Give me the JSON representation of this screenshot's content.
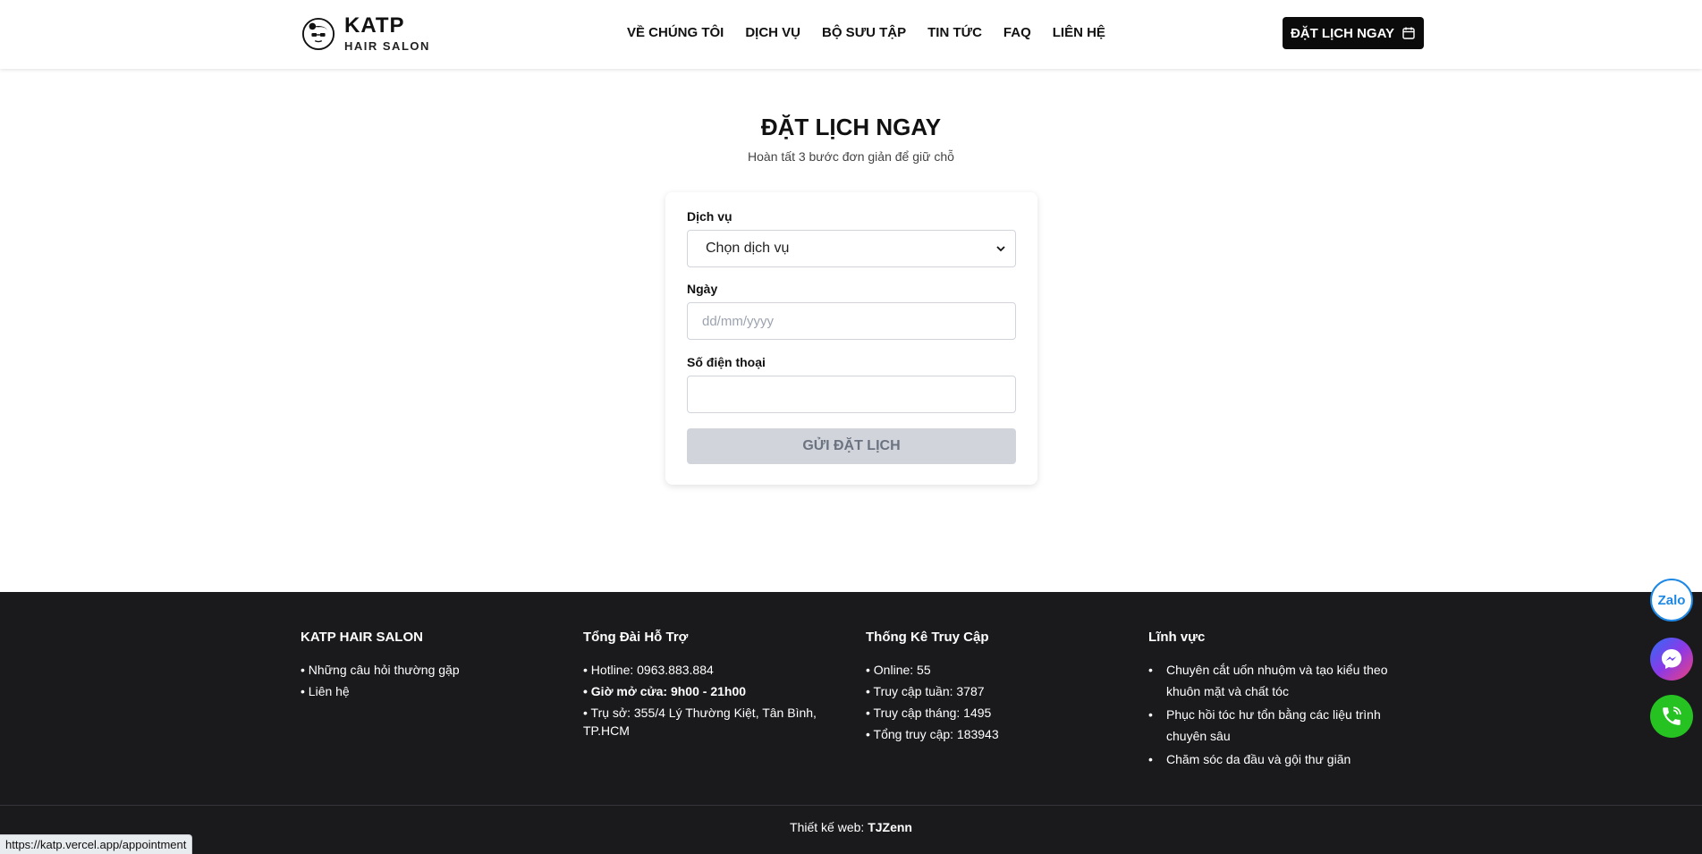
{
  "header": {
    "brand_title": "KATP",
    "brand_sub": "HAIR SALON",
    "nav": [
      "VỀ CHÚNG TÔI",
      "DỊCH VỤ",
      "BỘ SƯU TẬP",
      "TIN TỨC",
      "FAQ",
      "LIÊN HỆ"
    ],
    "cta_label": "ĐẶT LỊCH NGAY"
  },
  "main": {
    "title": "ĐẶT LỊCH NGAY",
    "subtitle": "Hoàn tất 3 bước đơn giản để giữ chỗ",
    "form": {
      "service_label": "Dịch vụ",
      "service_value": "Chọn dịch vụ",
      "date_label": "Ngày",
      "date_placeholder": "dd/mm/yyyy",
      "phone_label": "Số điện thoại",
      "phone_value": "",
      "submit_label": "GỬI ĐẶT LỊCH"
    }
  },
  "footer": {
    "col1": {
      "title": "KATP HAIR SALON",
      "items": [
        "• Những câu hỏi thường gặp",
        "• Liên hệ"
      ]
    },
    "col2": {
      "title": "Tổng Đài Hỗ Trợ",
      "items": [
        "• Hotline: 0963.883.884",
        "• Giờ mở cửa: 9h00 - 21h00",
        "• Trụ sở: 355/4 Lý Thường Kiệt, Tân Bình, TP.HCM"
      ]
    },
    "col3": {
      "title": "Thống Kê Truy Cập",
      "items": [
        "• Online: 55",
        "• Truy cập tuần: 3787",
        "• Truy cập tháng: 1495",
        "• Tổng truy cập: 183943"
      ]
    },
    "col4": {
      "title": "Lĩnh vực",
      "items": [
        "Chuyên cắt uốn nhuộm và tạo kiểu theo khuôn mặt và chất tóc",
        "Phục hồi tóc hư tổn bằng các liệu trình chuyên sâu",
        "Chăm sóc da đầu và gội thư giãn"
      ]
    },
    "credit_prefix": "Thiết kế web:",
    "credit_name": "TJZenn"
  },
  "floating": {
    "zalo_label": "Zalo"
  },
  "status_bar": {
    "url": "https://katp.vercel.app/appointment"
  },
  "colors": {
    "dark": "#1a1a1d",
    "cta": "#0b0b0b",
    "submit_disabled": "#d1d5db"
  }
}
